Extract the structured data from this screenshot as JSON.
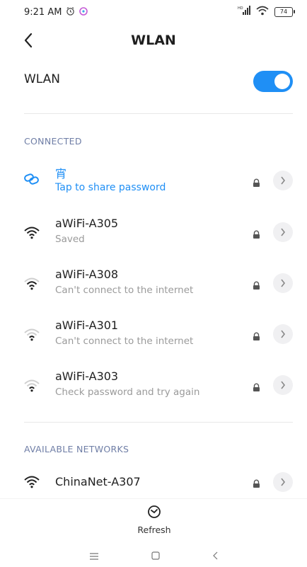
{
  "status": {
    "time": "9:21 AM",
    "battery": "74",
    "signal_label": "HD"
  },
  "header": {
    "title": "WLAN"
  },
  "wlan": {
    "label": "WLAN",
    "enabled": true
  },
  "connected": {
    "section_label": "CONNECTED",
    "name": "宵",
    "subtitle": "Tap to share password"
  },
  "saved_networks": [
    {
      "name": "aWiFi-A305",
      "subtitle": "Saved"
    },
    {
      "name": "aWiFi-A308",
      "subtitle": "Can't connect to the internet"
    },
    {
      "name": "aWiFi-A301",
      "subtitle": "Can't connect to the internet"
    },
    {
      "name": "aWiFi-A303",
      "subtitle": "Check password and try again"
    }
  ],
  "available": {
    "section_label": "AVAILABLE NETWORKS",
    "networks": [
      {
        "name": "ChinaNet-A307"
      }
    ]
  },
  "refresh": {
    "label": "Refresh"
  },
  "colors": {
    "accent": "#1f8ff5",
    "section": "#6f7ea6",
    "subtitle": "#9a9a9a"
  }
}
